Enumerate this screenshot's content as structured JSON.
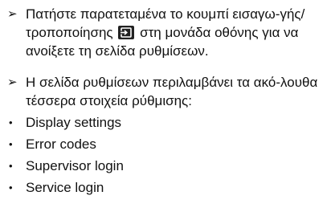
{
  "instructions": [
    {
      "marker": "➢",
      "text_before": "Πατήστε παρατεταμένα το κουμπί εισαγω-γής/τροποποίησης",
      "icon": "enter-modify-icon",
      "text_after": "στη μονάδα οθόνης για να ανοίξετε τη σελίδα ρυθμίσεων."
    },
    {
      "marker": "➢",
      "text": "Η σελίδα ρυθμίσεων περιλαμβάνει τα ακό-λουθα τέσσερα στοιχεία ρύθμισης:"
    }
  ],
  "settings_items": [
    {
      "bullet": "•",
      "label": "Display settings"
    },
    {
      "bullet": "•",
      "label": "Error codes"
    },
    {
      "bullet": "•",
      "label": "Supervisor login"
    },
    {
      "bullet": "•",
      "label": "Service login"
    }
  ],
  "colors": {
    "text": "#111111",
    "icon_background": "#222222",
    "icon_foreground": "#ffffff"
  }
}
